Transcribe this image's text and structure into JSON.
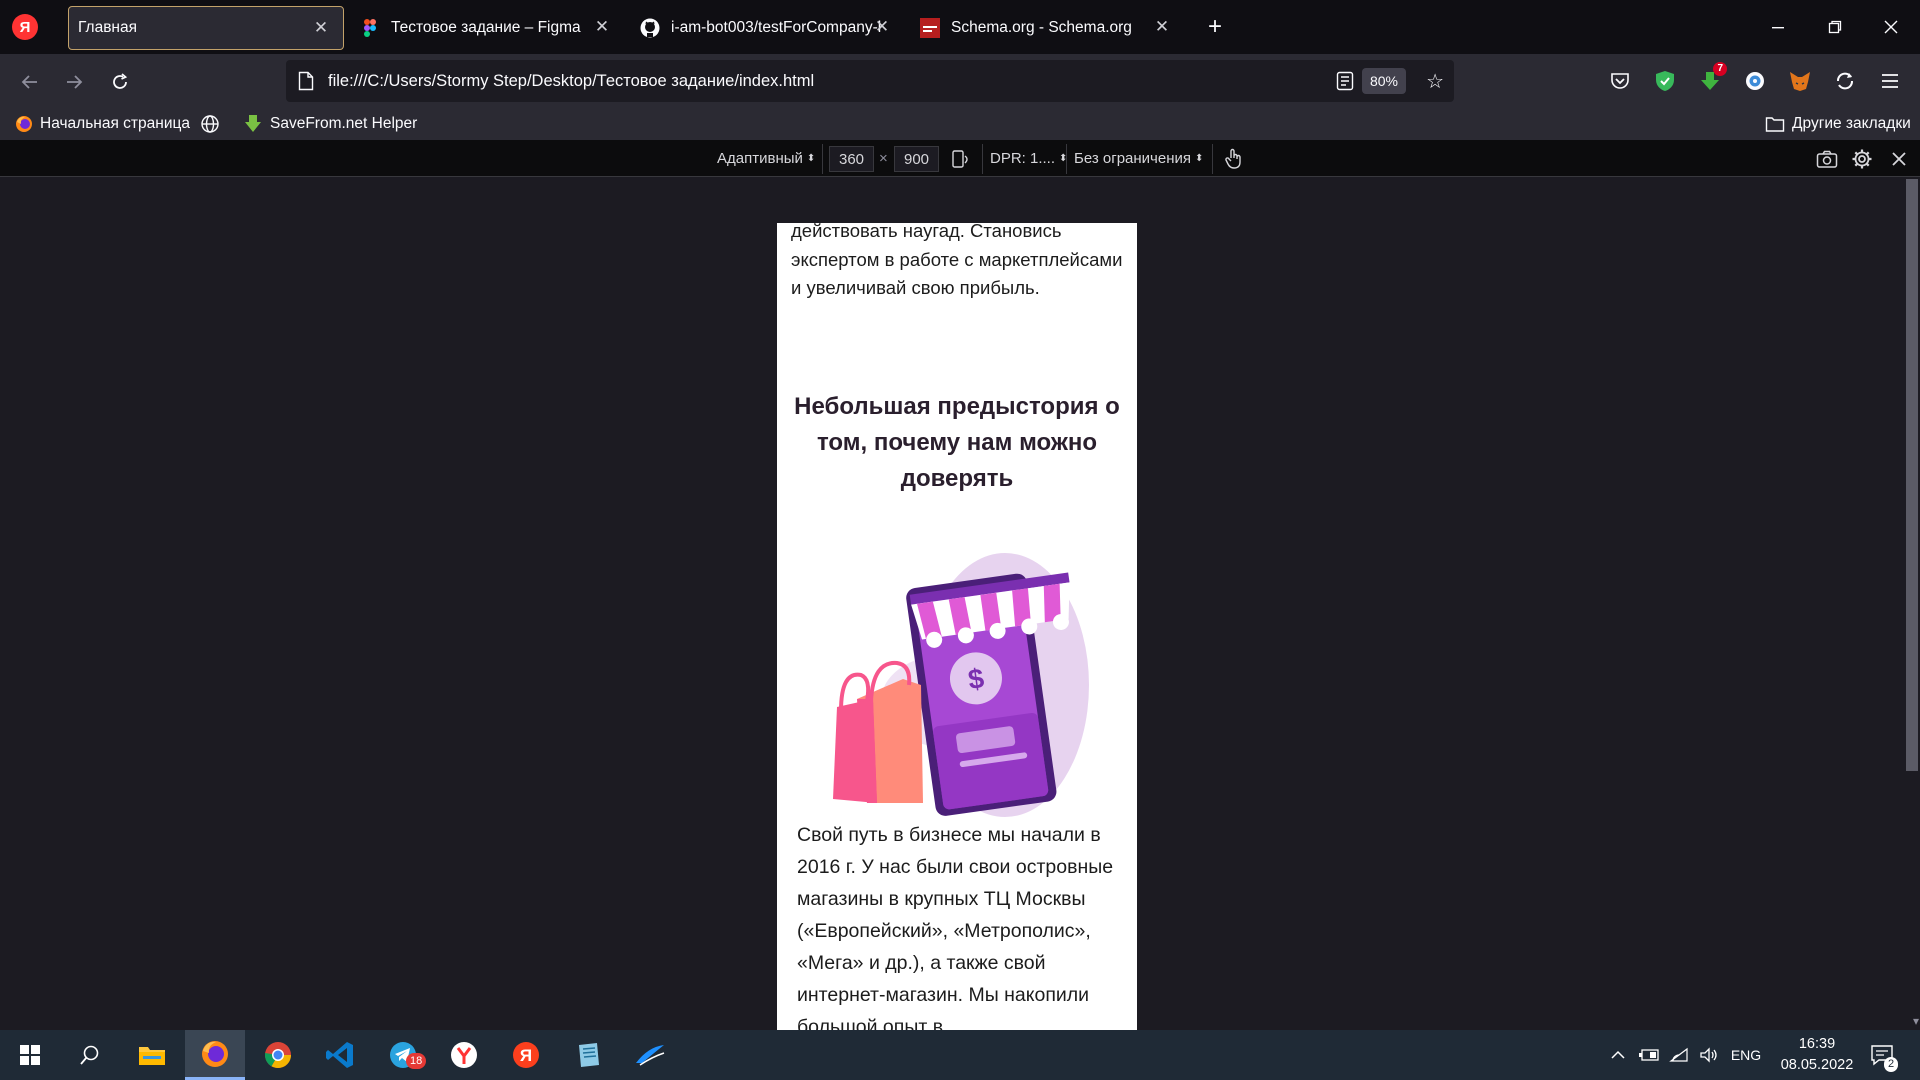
{
  "browser": {
    "tabs": [
      {
        "title": "Главная",
        "active": true
      },
      {
        "title": "Тестовое задание – Figma",
        "active": false
      },
      {
        "title": "i-am-bot003/testForCompany-l",
        "active": false
      },
      {
        "title": "Schema.org - Schema.org",
        "active": false
      }
    ],
    "address": "file:///C:/Users/Stormy Step/Desktop/Тестовое задание/index.html",
    "zoom": "80%",
    "bookmarks": {
      "home": "Начальная страница",
      "savefrom": "SaveFrom.net Helper",
      "other": "Другие закладки"
    },
    "extension_badge": "7"
  },
  "rdm": {
    "device": "Адаптивный",
    "width": "360",
    "times": "×",
    "height": "900",
    "dpr": "DPR: 1....",
    "throttling": "Без ограничения"
  },
  "page": {
    "intro_text": "действовать наугад. Становись экспертом в работе с маркетплейсами и увеличивай свою прибыль.",
    "history_heading": "Небольшая предыстория о том, почему нам можно доверять",
    "history_text": "Свой путь в бизнесе мы начали в 2016 г. У нас были свои островные магазины в крупных ТЦ Москвы («Европейский», «Метрополис», «Мега» и др.), а также свой интернет-магазин. Мы накопили большой опыт в",
    "illustration_symbol": "$"
  },
  "taskbar": {
    "telegram_badge": "18",
    "language": "ENG",
    "time": "16:39",
    "date": "08.05.2022",
    "notification_count": "2"
  },
  "colors": {
    "accent_tab_border": "#c3a26a",
    "illustration_purple": "#9b35c9",
    "illustration_pink": "#f7568c"
  }
}
